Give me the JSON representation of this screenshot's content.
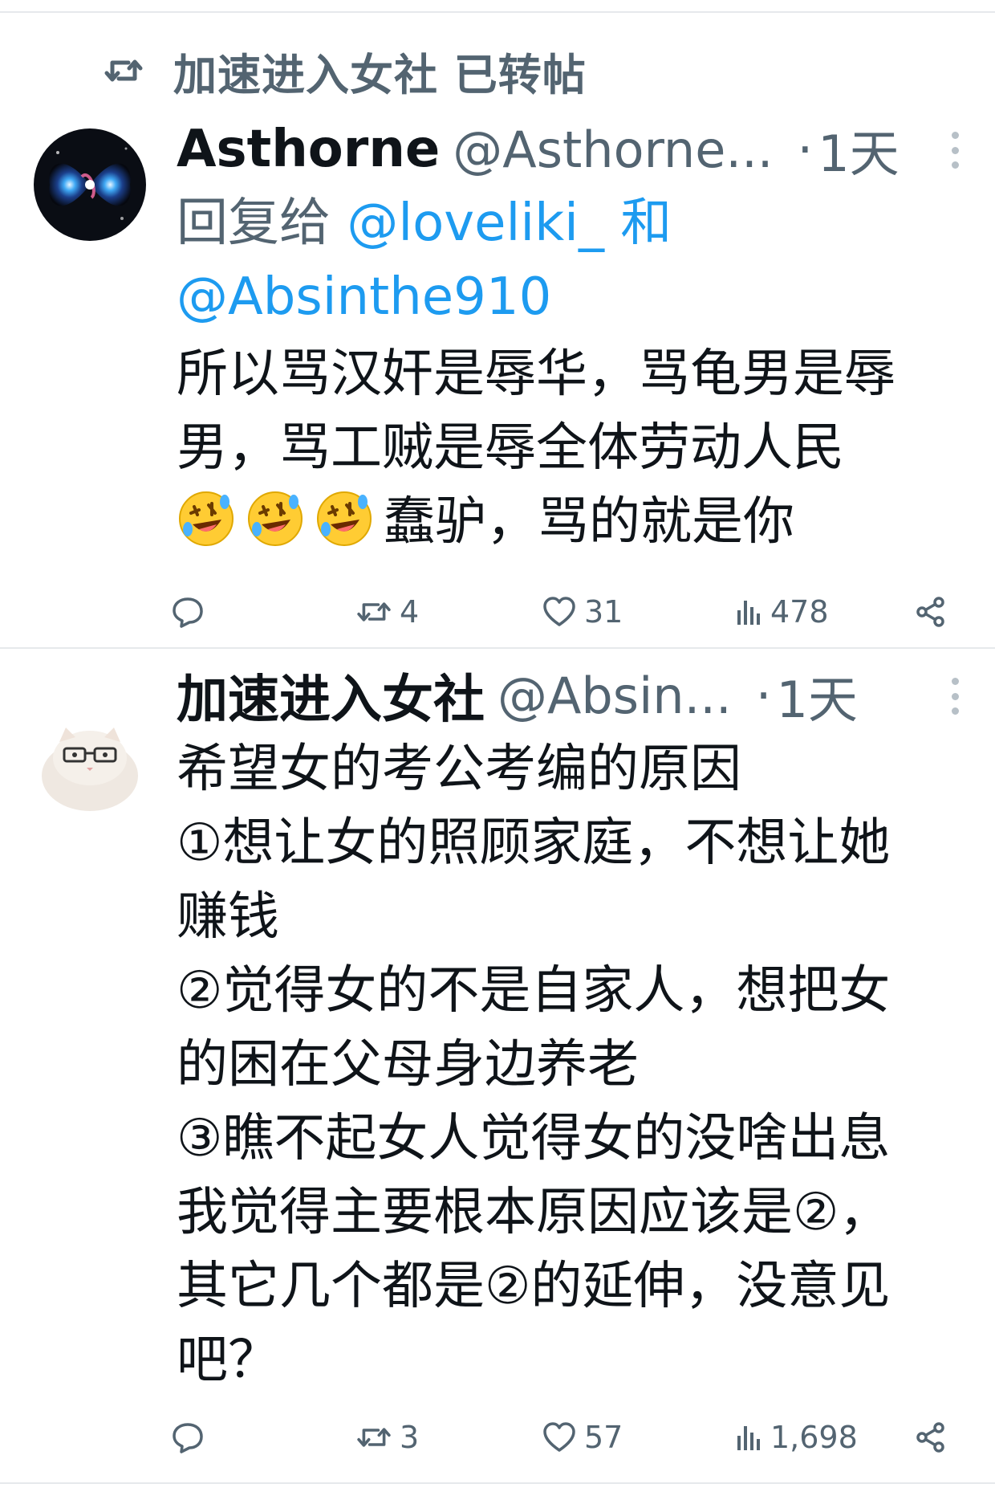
{
  "repost_banner": {
    "text": "加速进入女社 已转帖",
    "icon": "repost-icon"
  },
  "tweets": [
    {
      "display_name": "Asthorne",
      "handle": "@Asthorne...",
      "separator": "·",
      "time": "1天",
      "reply_prefix": "回复给",
      "reply_mention_1": "@loveliki_",
      "reply_conjunction": "和",
      "reply_mention_2": "@Absinthe910",
      "text_line_1": "所以骂汉奸是辱华，骂龟男是辱",
      "text_line_2": "男，骂工贼是辱全体劳动人民",
      "text_line_3": "蠢驴，骂的就是你",
      "emoji": "rolling-on-floor-laughing-emoji",
      "replies": "",
      "reposts": "4",
      "likes": "31",
      "views": "478"
    },
    {
      "display_name": "加速进入女社",
      "handle": "@Absin...",
      "separator": "·",
      "time": "1天",
      "text": "希望女的考公考编的原因\n①想让女的照顾家庭，不想让她\n赚钱\n②觉得女的不是自家人，想把女\n的困在父母身边养老\n③瞧不起女人觉得女的没啥出息\n我觉得主要根本原因应该是②，\n其它几个都是②的延伸，没意见\n吧？",
      "replies": "",
      "reposts": "3",
      "likes": "57",
      "views": "1,698"
    }
  ],
  "colors": {
    "text": "#0f1419",
    "secondary": "#536471",
    "link": "#1d9bf0",
    "divider": "#e6e9ec"
  }
}
